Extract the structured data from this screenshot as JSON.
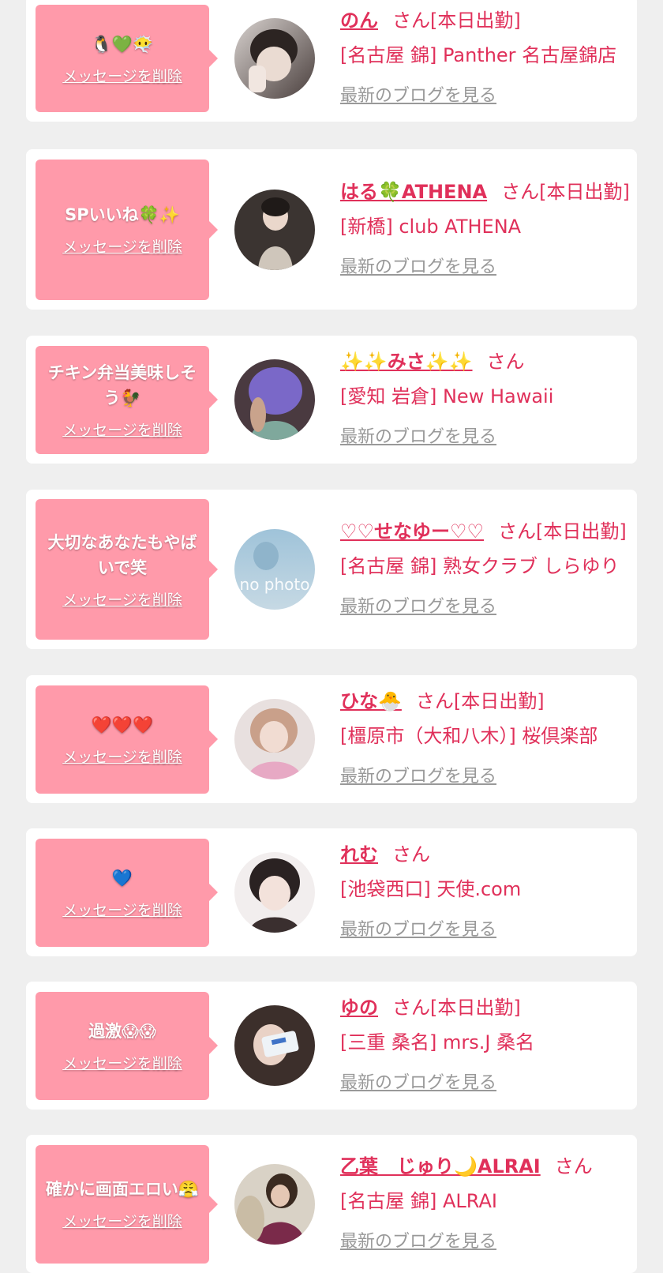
{
  "common": {
    "delete_label": "メッセージを削除",
    "blog_label": "最新のブログを見る"
  },
  "colors": {
    "page_bg": "#efefef",
    "card_bg": "#ffffff",
    "bubble_bg": "#ff9aaa",
    "accent": "#e0305a",
    "muted_link": "#999999"
  },
  "cards": [
    {
      "message": "🐧💚😶‍🌫️",
      "name": "のん",
      "status": "さん[本日出勤]",
      "shop": "[名古屋 錦] Panther 名古屋錦店",
      "avatar_icon": "photo-avatar"
    },
    {
      "message": "SPいいね🍀✨",
      "name": "はる🍀ATHENA",
      "status": "さん[本日出勤]",
      "shop": "[新橋] club ATHENA",
      "avatar_icon": "photo-avatar"
    },
    {
      "message": "チキン弁当美味しそう🐓",
      "name": "✨✨みさ✨✨",
      "status": "さん",
      "shop": "[愛知 岩倉] New Hawaii",
      "avatar_icon": "photo-avatar"
    },
    {
      "message": "大切なあなたもやばいで笑",
      "name": "♡♡せなゆー♡♡",
      "status": "さん[本日出勤]",
      "shop": "[名古屋 錦] 熟女クラブ しらゆり",
      "avatar_icon": "no-photo-avatar",
      "avatar_text": "no photo"
    },
    {
      "message": "❤️❤️❤️",
      "name": "ひな🐣",
      "status": "さん[本日出勤]",
      "shop": "[橿原市（大和八木）] 桜倶楽部",
      "avatar_icon": "photo-avatar"
    },
    {
      "message": "💙",
      "name": "れむ",
      "status": "さん",
      "shop": "[池袋西口] 天使.com",
      "avatar_icon": "photo-avatar"
    },
    {
      "message": "過激😱😱",
      "name": "ゆの",
      "status": "さん[本日出勤]",
      "shop": "[三重 桑名] mrs.J 桑名",
      "avatar_icon": "photo-avatar"
    },
    {
      "message": "確かに画面エロい😤",
      "name": "乙葉　じゅり🌙ALRAI",
      "status": "さん",
      "shop": "[名古屋 錦] ALRAI",
      "avatar_icon": "photo-avatar"
    }
  ]
}
